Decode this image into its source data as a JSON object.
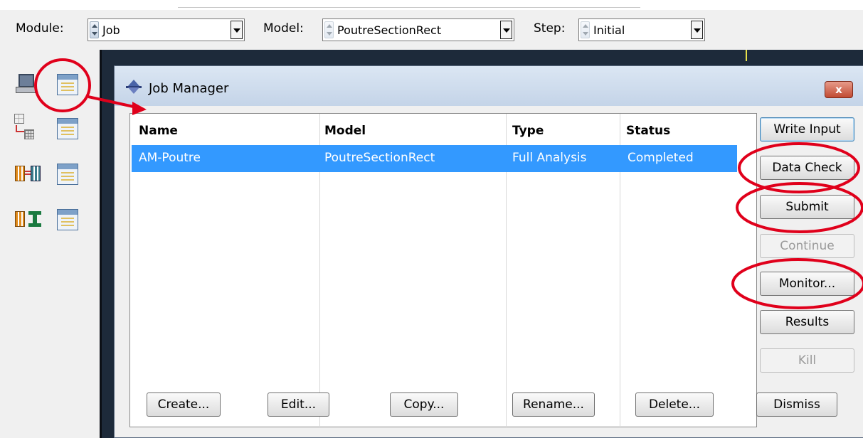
{
  "context_bar": {
    "module": {
      "label": "Module:",
      "value": "Job"
    },
    "model": {
      "label": "Model:",
      "value": "PoutreSectionRect"
    },
    "step": {
      "label": "Step:",
      "value": "Initial"
    }
  },
  "dialog": {
    "title": "Job Manager",
    "close_label": "x",
    "columns": [
      "Name",
      "Model",
      "Type",
      "Status"
    ],
    "rows": [
      {
        "name": "AM-Poutre",
        "model": "PoutreSectionRect",
        "type": "Full Analysis",
        "status": "Completed",
        "selected": true
      }
    ],
    "side_buttons": {
      "write_input": "Write Input",
      "data_check": "Data Check",
      "submit": "Submit",
      "continue": "Continue",
      "monitor": "Monitor...",
      "results": "Results",
      "kill": "Kill"
    },
    "bottom_buttons": {
      "create": "Create...",
      "edit": "Edit...",
      "copy": "Copy...",
      "rename": "Rename...",
      "delete": "Delete...",
      "dismiss": "Dismiss"
    }
  },
  "colors": {
    "selection": "#3399ff",
    "annotation": "#e0001b",
    "viewport": "#1d2a3a",
    "titlebar": "#c4d4e8"
  }
}
